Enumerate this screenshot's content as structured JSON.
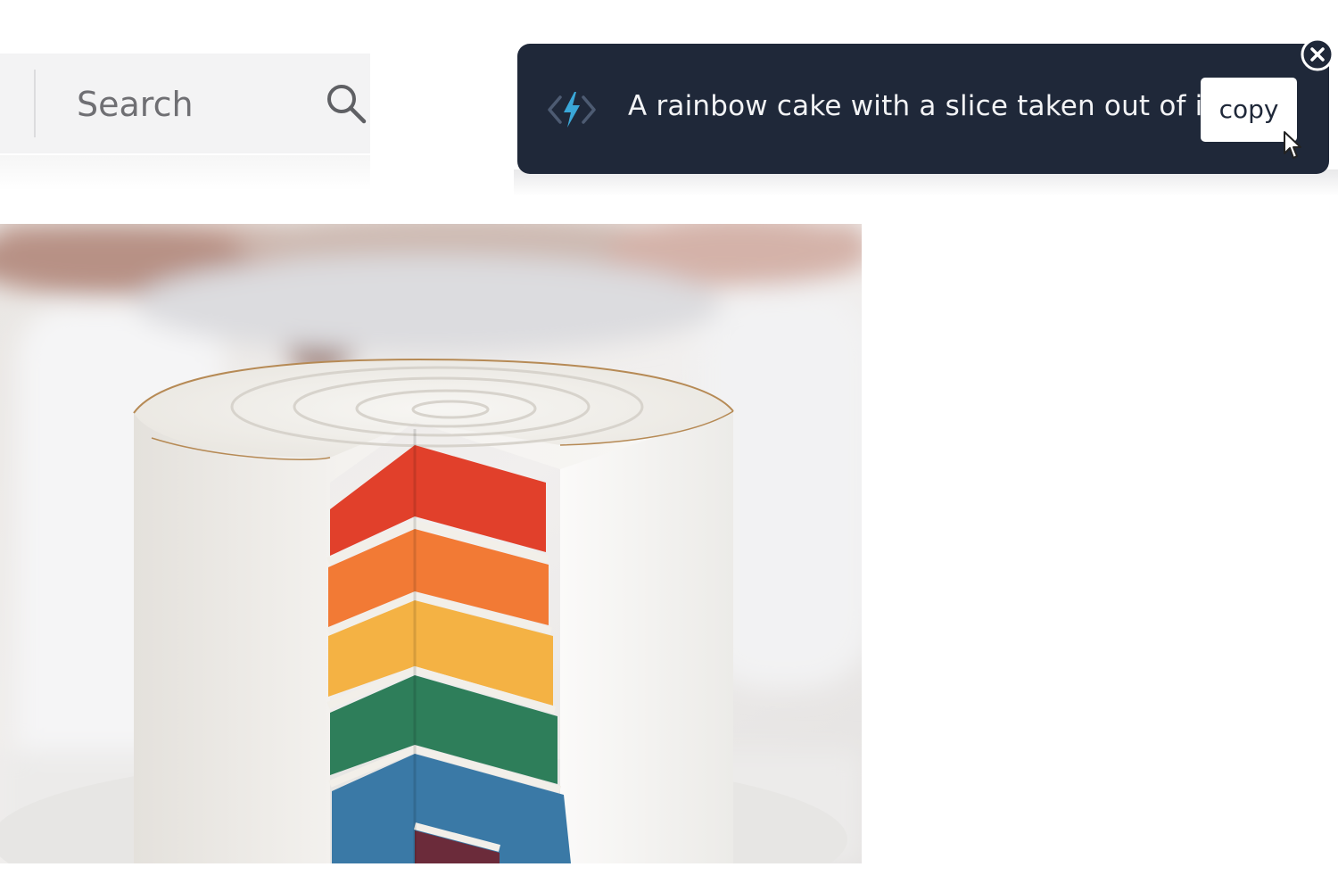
{
  "search": {
    "placeholder": "Search",
    "icon": "search-icon"
  },
  "caption_toast": {
    "logo_icon": "code-bolt-icon",
    "caption": "A rainbow cake with a slice taken out of it.",
    "copy_label": "copy",
    "close_icon": "close-icon",
    "background": "#1f2839",
    "accent": "#3aa7d8"
  },
  "image": {
    "subject": "rainbow-layer-cake"
  }
}
